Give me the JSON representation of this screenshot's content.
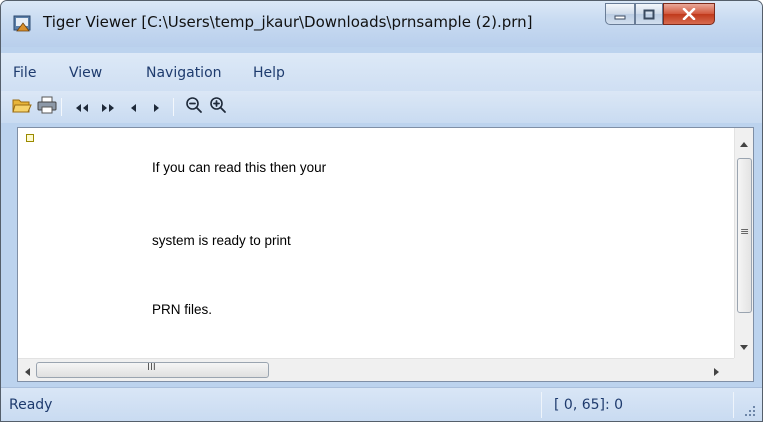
{
  "window": {
    "title": "Tiger Viewer [C:\\Users\\temp_jkaur\\Downloads\\prnsample (2).prn]",
    "icon": "tiger-viewer-app-icon",
    "controls": {
      "minimize": "minimize-icon",
      "maximize": "maximize-icon",
      "close": "close-icon"
    }
  },
  "menubar": {
    "items": [
      "File",
      "View",
      "Navigation",
      "Help"
    ]
  },
  "toolbar": {
    "buttons": [
      {
        "name": "open-button",
        "icon": "folder-open-icon"
      },
      {
        "name": "print-button",
        "icon": "printer-icon"
      },
      {
        "name": "first-page-button",
        "icon": "double-left-arrow-icon",
        "glyph": "◂◂"
      },
      {
        "name": "last-page-button",
        "icon": "double-right-arrow-icon",
        "glyph": "▸▸"
      },
      {
        "name": "previous-page-button",
        "icon": "left-arrow-icon",
        "glyph": "◂"
      },
      {
        "name": "next-page-button",
        "icon": "right-arrow-icon",
        "glyph": "▸"
      },
      {
        "name": "zoom-out-button",
        "icon": "zoom-out-icon"
      },
      {
        "name": "zoom-in-button",
        "icon": "zoom-in-icon"
      }
    ]
  },
  "document": {
    "lines": [
      "If you can read this then your",
      "system is ready to print",
      "PRN files."
    ]
  },
  "scrollbars": {
    "horizontal_grip": "III",
    "vertical_grip": "≡"
  },
  "statusbar": {
    "status": "Ready",
    "position": "[ 0, 65]: 0"
  },
  "colors": {
    "frame": "#bcd3ee",
    "menu_text": "#1e3b6e",
    "close_button": "#c0391b"
  }
}
